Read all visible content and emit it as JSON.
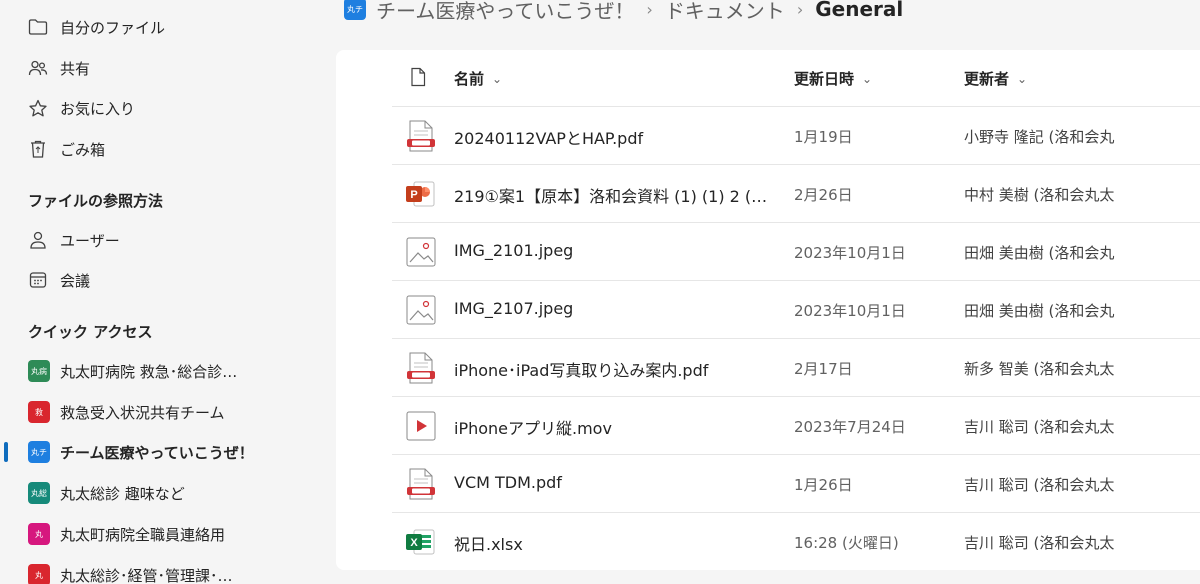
{
  "sidebar": {
    "nav": [
      {
        "label": "自分のファイル",
        "icon": "folder-icon"
      },
      {
        "label": "共有",
        "icon": "people-icon"
      },
      {
        "label": "お気に入り",
        "icon": "star-icon"
      },
      {
        "label": "ごみ箱",
        "icon": "recycle-bin-icon"
      }
    ],
    "browse_title": "ファイルの参照方法",
    "browse": [
      {
        "label": "ユーザー",
        "icon": "person-icon"
      },
      {
        "label": "会議",
        "icon": "calendar-icon"
      }
    ],
    "quick_access_title": "クイック アクセス",
    "quick_access": [
      {
        "label": "丸太町病院 救急･総合診…",
        "badge": "丸病",
        "color": "#2e8b57"
      },
      {
        "label": "救急受入状況共有チーム",
        "badge": "救",
        "color": "#d9262e"
      },
      {
        "label": "チーム医療やっていこうぜ！",
        "badge": "丸チ",
        "color": "#1e7fe0"
      },
      {
        "label": "丸太総診 趣味など",
        "badge": "丸総",
        "color": "#168a7a"
      },
      {
        "label": "丸太町病院全職員連絡用",
        "badge": "丸",
        "color": "#d6177e"
      },
      {
        "label": "丸太総診･経管･管理課･…",
        "badge": "丸",
        "color": "#d9262e"
      }
    ]
  },
  "breadcrumb": {
    "badge": "丸チ",
    "items": [
      "チーム医療やっていこうぜ！",
      "ドキュメント",
      "General"
    ]
  },
  "columns": {
    "name": "名前",
    "modified": "更新日時",
    "modified_by": "更新者"
  },
  "files": [
    {
      "name": "20240112VAPとHAP.pdf",
      "type": "pdf",
      "date": "1月19日",
      "user": "小野寺 隆記 (洛和会丸"
    },
    {
      "name": "219①案1【原本】洛和会資料 (1) (1) 2 (1…",
      "type": "pptx",
      "date": "2月26日",
      "user": "中村 美樹 (洛和会丸太"
    },
    {
      "name": "IMG_2101.jpeg",
      "type": "image",
      "date": "2023年10月1日",
      "user": "田畑 美由樹 (洛和会丸"
    },
    {
      "name": "IMG_2107.jpeg",
      "type": "image",
      "date": "2023年10月1日",
      "user": "田畑 美由樹 (洛和会丸"
    },
    {
      "name": "iPhone･iPad写真取り込み案内.pdf",
      "type": "pdf",
      "date": "2月17日",
      "user": "新多 智美 (洛和会丸太"
    },
    {
      "name": "iPhoneアプリ縦.mov",
      "type": "video",
      "date": "2023年7月24日",
      "user": "吉川 聡司 (洛和会丸太"
    },
    {
      "name": "VCM TDM.pdf",
      "type": "pdf",
      "date": "1月26日",
      "user": "吉川 聡司 (洛和会丸太"
    },
    {
      "name": "祝日.xlsx",
      "type": "xlsx",
      "date": "16:28 (火曜日)",
      "user": "吉川 聡司 (洛和会丸太"
    }
  ]
}
